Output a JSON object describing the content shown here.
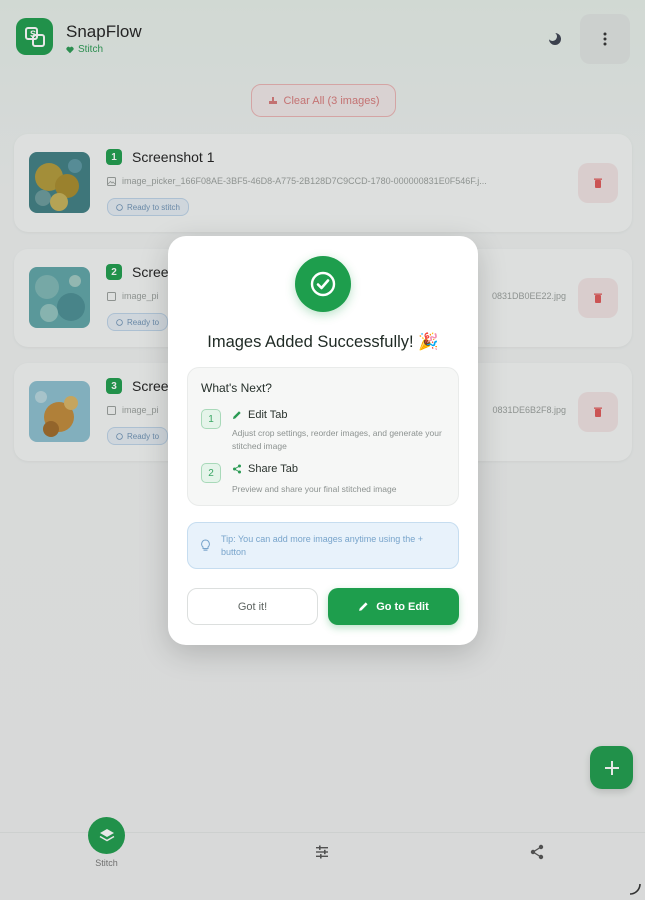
{
  "app": {
    "title": "SnapFlow",
    "subtitle": "Stitch"
  },
  "toolbar": {
    "clear_all_label": "Clear All (3 images)"
  },
  "images": [
    {
      "number": "1",
      "title": "Screenshot 1",
      "filename": "image_picker_166F08AE-3BF5-46D8-A775-2B128D7C9CCD-1780-000000831E0F546F.j...",
      "filename_tail": "",
      "status": "Ready to stitch"
    },
    {
      "number": "2",
      "title": "Scree",
      "filename": "image_pi",
      "filename_tail": "0831DB0EE22.jpg",
      "status": "Ready to"
    },
    {
      "number": "3",
      "title": "Scree",
      "filename": "image_pi",
      "filename_tail": "0831DE6B2F8.jpg",
      "status": "Ready to"
    }
  ],
  "dialog": {
    "title": "Images Added Successfully! 🎉",
    "next_title": "What's Next?",
    "steps": [
      {
        "number": "1",
        "title": "Edit Tab",
        "description": "Adjust crop settings, reorder images, and generate your stitched image"
      },
      {
        "number": "2",
        "title": "Share Tab",
        "description": "Preview and share your final stitched image"
      }
    ],
    "tip": "Tip: You can add more images anytime using the + button",
    "got_it_label": "Got it!",
    "go_edit_label": "Go to Edit"
  },
  "nav": {
    "stitch_label": "Stitch"
  },
  "colors": {
    "accent": "#1e9e4d",
    "danger": "#d77a7a",
    "info": "#78a4cb"
  }
}
